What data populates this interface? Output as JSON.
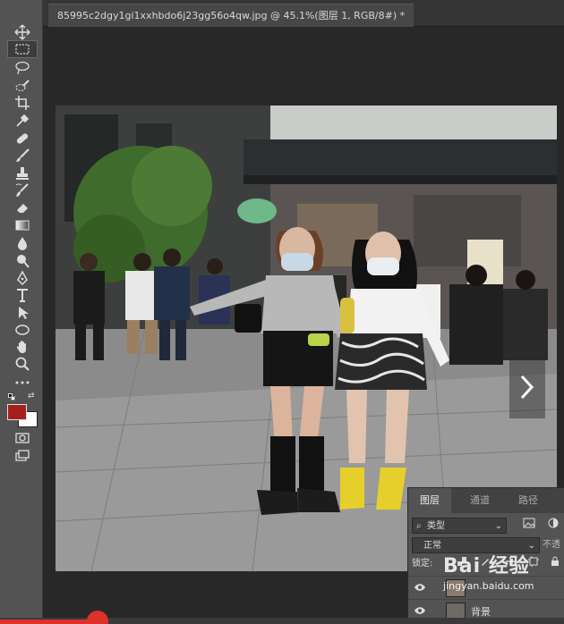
{
  "document": {
    "tab_title": "85995c2dgy1gi1xxhbdo6j23gg56o4qw.jpg @ 45.1%(图层 1, RGB/8#) *"
  },
  "toolbar": {
    "tools": [
      "move-tool",
      "marquee-tool",
      "lasso-tool",
      "quick-select-tool",
      "crop-tool",
      "eyedropper-tool",
      "healing-brush-tool",
      "brush-tool",
      "clone-stamp-tool",
      "history-brush-tool",
      "eraser-tool",
      "gradient-tool",
      "blur-tool",
      "dodge-tool",
      "pen-tool",
      "type-tool",
      "path-select-tool",
      "ellipse-tool",
      "hand-tool",
      "zoom-tool",
      "more-tools"
    ],
    "foreground_color": "#a61f1f",
    "background_color": "#ffffff"
  },
  "layers_panel": {
    "tabs": [
      "图层",
      "通道",
      "路径"
    ],
    "filter_label": "类型",
    "blend_mode": "正常",
    "opacity_label": "不透",
    "lock_label": "锁定:",
    "layers": [
      {
        "name": "",
        "visible": true
      },
      {
        "name": "背景",
        "visible": true
      }
    ]
  },
  "watermark": {
    "text": "Bai 经验",
    "url": "jingyan.baidu.com"
  }
}
